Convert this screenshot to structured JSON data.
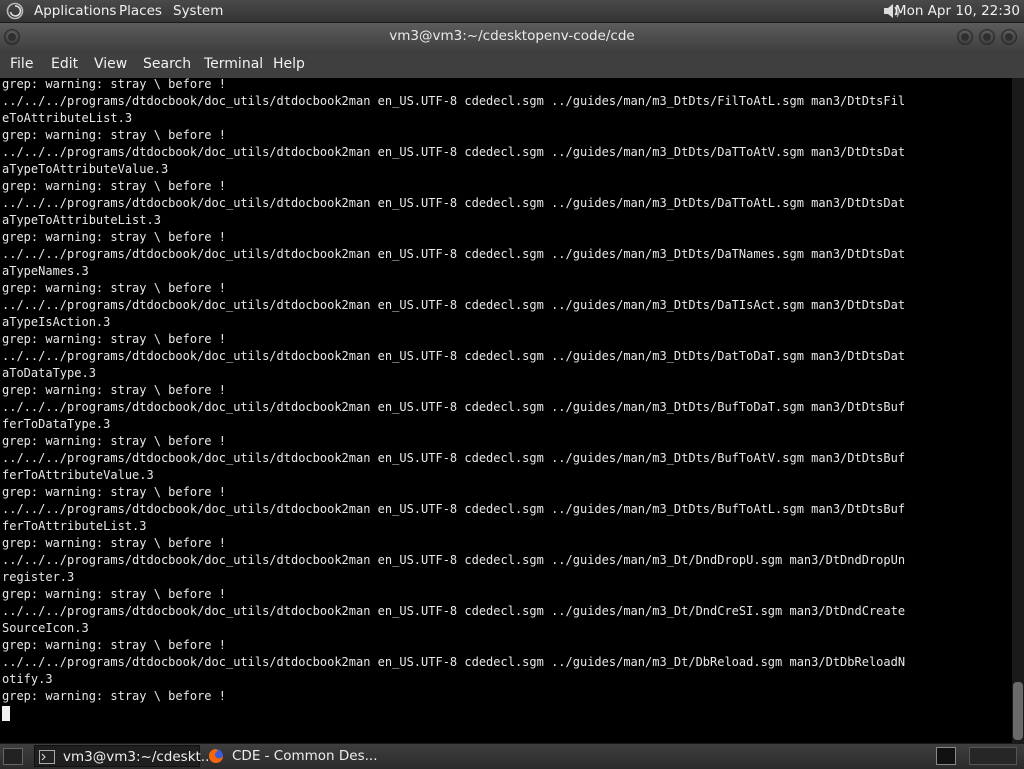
{
  "top_panel": {
    "menus": [
      "Applications",
      "Places",
      "System"
    ],
    "clock": "Mon Apr 10, 22:30"
  },
  "window": {
    "title": "vm3@vm3:~/cdesktopenv-code/cde"
  },
  "menubar": [
    "File",
    "Edit",
    "View",
    "Search",
    "Terminal",
    "Help"
  ],
  "terminal": {
    "lines": [
      "grep: warning: stray \\ before !",
      "../../../programs/dtdocbook/doc_utils/dtdocbook2man en_US.UTF-8 cdedecl.sgm ../guides/man/m3_DtDts/FilToAtL.sgm man3/DtDtsFil",
      "eToAttributeList.3",
      "grep: warning: stray \\ before !",
      "../../../programs/dtdocbook/doc_utils/dtdocbook2man en_US.UTF-8 cdedecl.sgm ../guides/man/m3_DtDts/DaTToAtV.sgm man3/DtDtsDat",
      "aTypeToAttributeValue.3",
      "grep: warning: stray \\ before !",
      "../../../programs/dtdocbook/doc_utils/dtdocbook2man en_US.UTF-8 cdedecl.sgm ../guides/man/m3_DtDts/DaTToAtL.sgm man3/DtDtsDat",
      "aTypeToAttributeList.3",
      "grep: warning: stray \\ before !",
      "../../../programs/dtdocbook/doc_utils/dtdocbook2man en_US.UTF-8 cdedecl.sgm ../guides/man/m3_DtDts/DaTNames.sgm man3/DtDtsDat",
      "aTypeNames.3",
      "grep: warning: stray \\ before !",
      "../../../programs/dtdocbook/doc_utils/dtdocbook2man en_US.UTF-8 cdedecl.sgm ../guides/man/m3_DtDts/DaTIsAct.sgm man3/DtDtsDat",
      "aTypeIsAction.3",
      "grep: warning: stray \\ before !",
      "../../../programs/dtdocbook/doc_utils/dtdocbook2man en_US.UTF-8 cdedecl.sgm ../guides/man/m3_DtDts/DatToDaT.sgm man3/DtDtsDat",
      "aToDataType.3",
      "grep: warning: stray \\ before !",
      "../../../programs/dtdocbook/doc_utils/dtdocbook2man en_US.UTF-8 cdedecl.sgm ../guides/man/m3_DtDts/BufToDaT.sgm man3/DtDtsBuf",
      "ferToDataType.3",
      "grep: warning: stray \\ before !",
      "../../../programs/dtdocbook/doc_utils/dtdocbook2man en_US.UTF-8 cdedecl.sgm ../guides/man/m3_DtDts/BufToAtV.sgm man3/DtDtsBuf",
      "ferToAttributeValue.3",
      "grep: warning: stray \\ before !",
      "../../../programs/dtdocbook/doc_utils/dtdocbook2man en_US.UTF-8 cdedecl.sgm ../guides/man/m3_DtDts/BufToAtL.sgm man3/DtDtsBuf",
      "ferToAttributeList.3",
      "grep: warning: stray \\ before !",
      "../../../programs/dtdocbook/doc_utils/dtdocbook2man en_US.UTF-8 cdedecl.sgm ../guides/man/m3_Dt/DndDropU.sgm man3/DtDndDropUn",
      "register.3",
      "grep: warning: stray \\ before !",
      "../../../programs/dtdocbook/doc_utils/dtdocbook2man en_US.UTF-8 cdedecl.sgm ../guides/man/m3_Dt/DndCreSI.sgm man3/DtDndCreate",
      "SourceIcon.3",
      "grep: warning: stray \\ before !",
      "../../../programs/dtdocbook/doc_utils/dtdocbook2man en_US.UTF-8 cdedecl.sgm ../guides/man/m3_Dt/DbReload.sgm man3/DtDbReloadN",
      "otify.3",
      "grep: warning: stray \\ before !"
    ]
  },
  "taskbar": {
    "tasks": [
      "vm3@vm3:~/cdeskt...",
      "CDE - Common Des..."
    ]
  },
  "colors": {
    "terminal_bg": "#000000",
    "terminal_fg": "#e8e8e8",
    "panel_bg": "#3a3a3a"
  },
  "icons": {
    "distro": "debian-swirl-icon",
    "volume": "speaker-icon",
    "terminal_task": "terminal-icon",
    "browser_task": "firefox-icon"
  }
}
